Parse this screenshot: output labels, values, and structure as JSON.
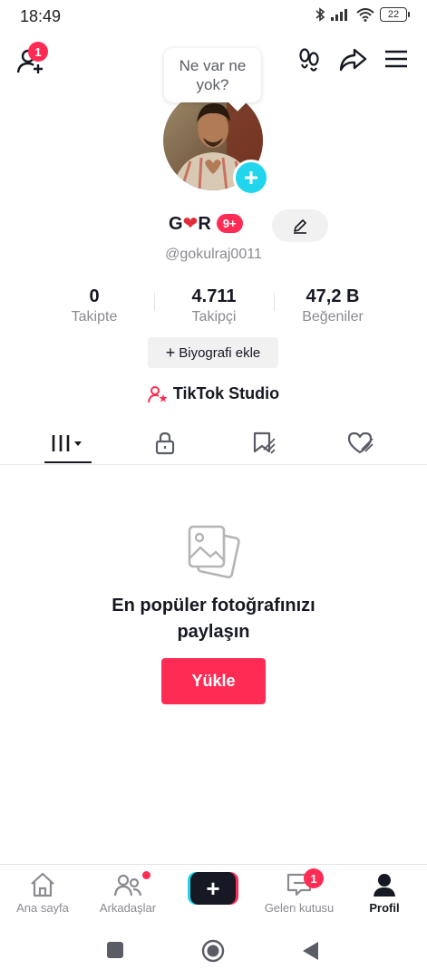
{
  "status": {
    "time": "18:49",
    "battery": "22"
  },
  "header": {
    "add_friend_badge": "1"
  },
  "tooltip": {
    "line1": "Ne var ne",
    "line2": "yok?"
  },
  "profile": {
    "display_name_start": "G",
    "display_name_heart": "❤",
    "display_name_end": "R",
    "notification_badge": "9+",
    "username": "@gokulraj0011"
  },
  "stats": [
    {
      "value": "0",
      "label": "Takipte"
    },
    {
      "value": "4.711",
      "label": "Takipçi"
    },
    {
      "value": "47,2 B",
      "label": "Beğeniler"
    }
  ],
  "bio_button": {
    "plus": "+",
    "label": "Biyografi ekle"
  },
  "studio": {
    "label": "TikTok Studio"
  },
  "empty_state": {
    "title_line1": "En popüler fotoğrafınızı",
    "title_line2": "paylaşın",
    "button": "Yükle"
  },
  "bottom_nav": {
    "items": [
      {
        "label": "Ana sayfa"
      },
      {
        "label": "Arkadaşlar"
      },
      {
        "label": "Gelen kutusu",
        "badge": "1"
      },
      {
        "label": "Profil"
      }
    ],
    "create_plus": "+"
  },
  "colors": {
    "accent": "#fe2c55",
    "cyan": "#20d5ec",
    "text": "#161823",
    "muted": "#8a8b91"
  },
  "icons": [
    "bluetooth-icon",
    "signal-icon",
    "wifi-icon",
    "battery-icon",
    "add-friend-icon",
    "footprints-icon",
    "share-icon",
    "menu-icon",
    "edit-icon",
    "studio-icon",
    "grid-icon",
    "lock-icon",
    "saved-icon",
    "liked-icon",
    "photo-icon",
    "home-icon",
    "friends-icon",
    "inbox-icon",
    "profile-icon",
    "square-icon",
    "circle-icon",
    "back-icon"
  ]
}
